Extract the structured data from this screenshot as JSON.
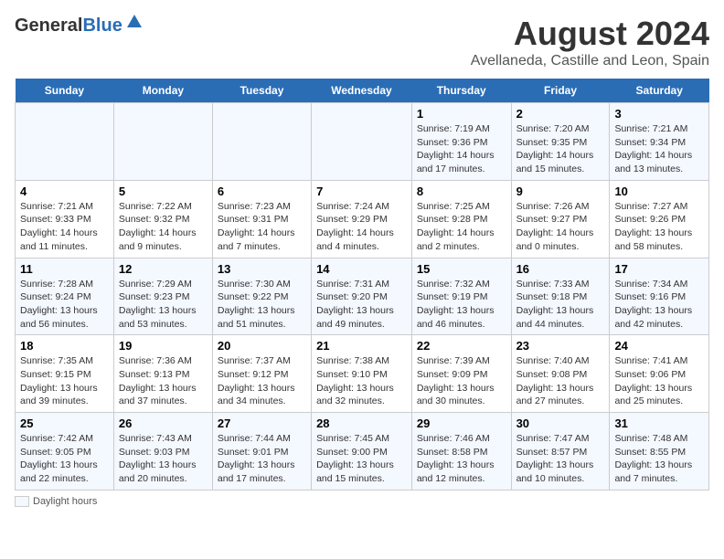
{
  "header": {
    "logo_general": "General",
    "logo_blue": "Blue",
    "main_title": "August 2024",
    "subtitle": "Avellaneda, Castille and Leon, Spain"
  },
  "days_of_week": [
    "Sunday",
    "Monday",
    "Tuesday",
    "Wednesday",
    "Thursday",
    "Friday",
    "Saturday"
  ],
  "weeks": [
    [
      {
        "date": "",
        "info": ""
      },
      {
        "date": "",
        "info": ""
      },
      {
        "date": "",
        "info": ""
      },
      {
        "date": "",
        "info": ""
      },
      {
        "date": "1",
        "info": "Sunrise: 7:19 AM\nSunset: 9:36 PM\nDaylight: 14 hours and 17 minutes."
      },
      {
        "date": "2",
        "info": "Sunrise: 7:20 AM\nSunset: 9:35 PM\nDaylight: 14 hours and 15 minutes."
      },
      {
        "date": "3",
        "info": "Sunrise: 7:21 AM\nSunset: 9:34 PM\nDaylight: 14 hours and 13 minutes."
      }
    ],
    [
      {
        "date": "4",
        "info": "Sunrise: 7:21 AM\nSunset: 9:33 PM\nDaylight: 14 hours and 11 minutes."
      },
      {
        "date": "5",
        "info": "Sunrise: 7:22 AM\nSunset: 9:32 PM\nDaylight: 14 hours and 9 minutes."
      },
      {
        "date": "6",
        "info": "Sunrise: 7:23 AM\nSunset: 9:31 PM\nDaylight: 14 hours and 7 minutes."
      },
      {
        "date": "7",
        "info": "Sunrise: 7:24 AM\nSunset: 9:29 PM\nDaylight: 14 hours and 4 minutes."
      },
      {
        "date": "8",
        "info": "Sunrise: 7:25 AM\nSunset: 9:28 PM\nDaylight: 14 hours and 2 minutes."
      },
      {
        "date": "9",
        "info": "Sunrise: 7:26 AM\nSunset: 9:27 PM\nDaylight: 14 hours and 0 minutes."
      },
      {
        "date": "10",
        "info": "Sunrise: 7:27 AM\nSunset: 9:26 PM\nDaylight: 13 hours and 58 minutes."
      }
    ],
    [
      {
        "date": "11",
        "info": "Sunrise: 7:28 AM\nSunset: 9:24 PM\nDaylight: 13 hours and 56 minutes."
      },
      {
        "date": "12",
        "info": "Sunrise: 7:29 AM\nSunset: 9:23 PM\nDaylight: 13 hours and 53 minutes."
      },
      {
        "date": "13",
        "info": "Sunrise: 7:30 AM\nSunset: 9:22 PM\nDaylight: 13 hours and 51 minutes."
      },
      {
        "date": "14",
        "info": "Sunrise: 7:31 AM\nSunset: 9:20 PM\nDaylight: 13 hours and 49 minutes."
      },
      {
        "date": "15",
        "info": "Sunrise: 7:32 AM\nSunset: 9:19 PM\nDaylight: 13 hours and 46 minutes."
      },
      {
        "date": "16",
        "info": "Sunrise: 7:33 AM\nSunset: 9:18 PM\nDaylight: 13 hours and 44 minutes."
      },
      {
        "date": "17",
        "info": "Sunrise: 7:34 AM\nSunset: 9:16 PM\nDaylight: 13 hours and 42 minutes."
      }
    ],
    [
      {
        "date": "18",
        "info": "Sunrise: 7:35 AM\nSunset: 9:15 PM\nDaylight: 13 hours and 39 minutes."
      },
      {
        "date": "19",
        "info": "Sunrise: 7:36 AM\nSunset: 9:13 PM\nDaylight: 13 hours and 37 minutes."
      },
      {
        "date": "20",
        "info": "Sunrise: 7:37 AM\nSunset: 9:12 PM\nDaylight: 13 hours and 34 minutes."
      },
      {
        "date": "21",
        "info": "Sunrise: 7:38 AM\nSunset: 9:10 PM\nDaylight: 13 hours and 32 minutes."
      },
      {
        "date": "22",
        "info": "Sunrise: 7:39 AM\nSunset: 9:09 PM\nDaylight: 13 hours and 30 minutes."
      },
      {
        "date": "23",
        "info": "Sunrise: 7:40 AM\nSunset: 9:08 PM\nDaylight: 13 hours and 27 minutes."
      },
      {
        "date": "24",
        "info": "Sunrise: 7:41 AM\nSunset: 9:06 PM\nDaylight: 13 hours and 25 minutes."
      }
    ],
    [
      {
        "date": "25",
        "info": "Sunrise: 7:42 AM\nSunset: 9:05 PM\nDaylight: 13 hours and 22 minutes."
      },
      {
        "date": "26",
        "info": "Sunrise: 7:43 AM\nSunset: 9:03 PM\nDaylight: 13 hours and 20 minutes."
      },
      {
        "date": "27",
        "info": "Sunrise: 7:44 AM\nSunset: 9:01 PM\nDaylight: 13 hours and 17 minutes."
      },
      {
        "date": "28",
        "info": "Sunrise: 7:45 AM\nSunset: 9:00 PM\nDaylight: 13 hours and 15 minutes."
      },
      {
        "date": "29",
        "info": "Sunrise: 7:46 AM\nSunset: 8:58 PM\nDaylight: 13 hours and 12 minutes."
      },
      {
        "date": "30",
        "info": "Sunrise: 7:47 AM\nSunset: 8:57 PM\nDaylight: 13 hours and 10 minutes."
      },
      {
        "date": "31",
        "info": "Sunrise: 7:48 AM\nSunset: 8:55 PM\nDaylight: 13 hours and 7 minutes."
      }
    ]
  ],
  "footer": {
    "daylight_label": "Daylight hours"
  }
}
